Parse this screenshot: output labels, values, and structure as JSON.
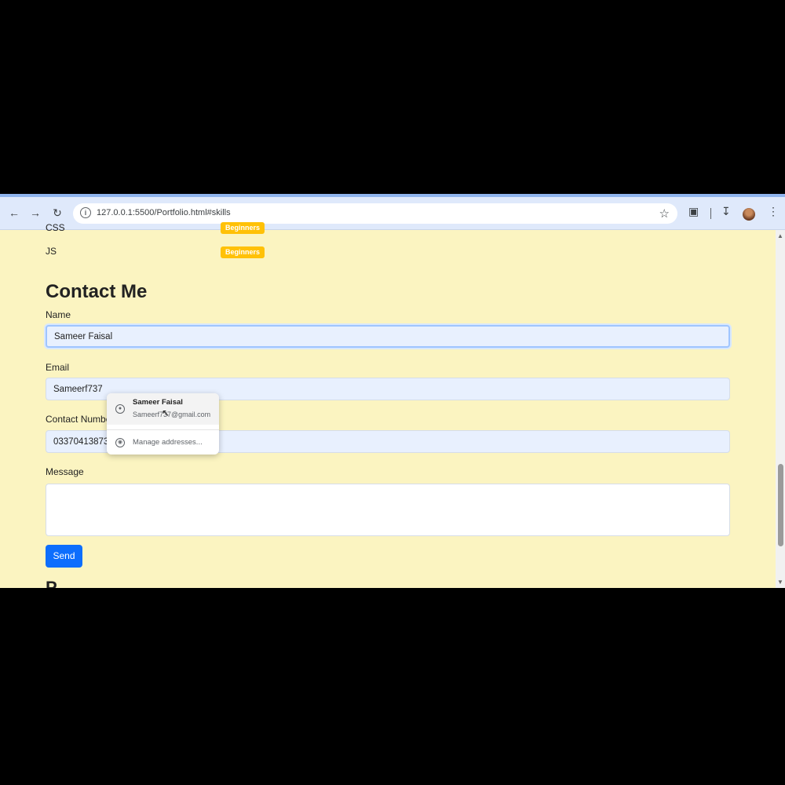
{
  "browser": {
    "url": "127.0.0.1:5500/Portfolio.html#skills",
    "icons": {
      "back": "back-arrow-icon",
      "forward": "forward-arrow-icon",
      "reload": "reload-icon",
      "info": "site-info-icon",
      "bookmark": "star-icon",
      "extensions": "puzzle-icon",
      "download": "download-icon",
      "menu": "kebab-menu-icon"
    },
    "accent_color": "#dfe9fb"
  },
  "skills": [
    {
      "name": "CSS",
      "level": "Beginners"
    },
    {
      "name": "JS",
      "level": "Beginners"
    }
  ],
  "contact": {
    "heading": "Contact Me",
    "name_label": "Name",
    "name_value": "Sameer Faisal",
    "email_label": "Email",
    "email_value": "Sameerf737",
    "phone_label": "Contact Number",
    "phone_value": "03370413873",
    "message_label": "Message",
    "message_value": "",
    "send_label": "Send",
    "send_color": "#0d6efd"
  },
  "autofill": {
    "name": "Sameer Faisal",
    "email": "Sameerf737@gmail.com",
    "manage": "Manage addresses..."
  },
  "next_section_heading": "P",
  "page_background": "#fbf4c1"
}
